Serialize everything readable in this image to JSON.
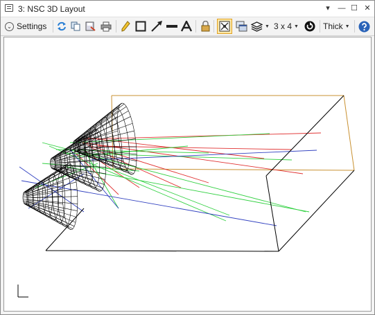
{
  "window": {
    "title": "3: NSC 3D Layout"
  },
  "title_controls": {
    "menu": "▾",
    "minimize": "—",
    "maximize": "☐",
    "close": "✕"
  },
  "toolbar": {
    "settings_label": "Settings",
    "layout_label": "3 x 4",
    "thickness_label": "Thick"
  },
  "colors": {
    "accent_active": "#f0b43c",
    "ray_red": "#e03030",
    "ray_green": "#30d040",
    "ray_blue": "#3040c0",
    "detector_outline": "#c89030",
    "wireframe": "#000000"
  },
  "icons": [
    "chevron-down-icon",
    "refresh-icon",
    "copy-icon",
    "save-icon",
    "print-icon",
    "pencil-icon",
    "rectangle-icon",
    "arrow-icon",
    "line-icon",
    "text-icon",
    "lock-icon",
    "fit-icon",
    "windows-icon",
    "layers-icon",
    "rotate-icon",
    "help-icon"
  ]
}
